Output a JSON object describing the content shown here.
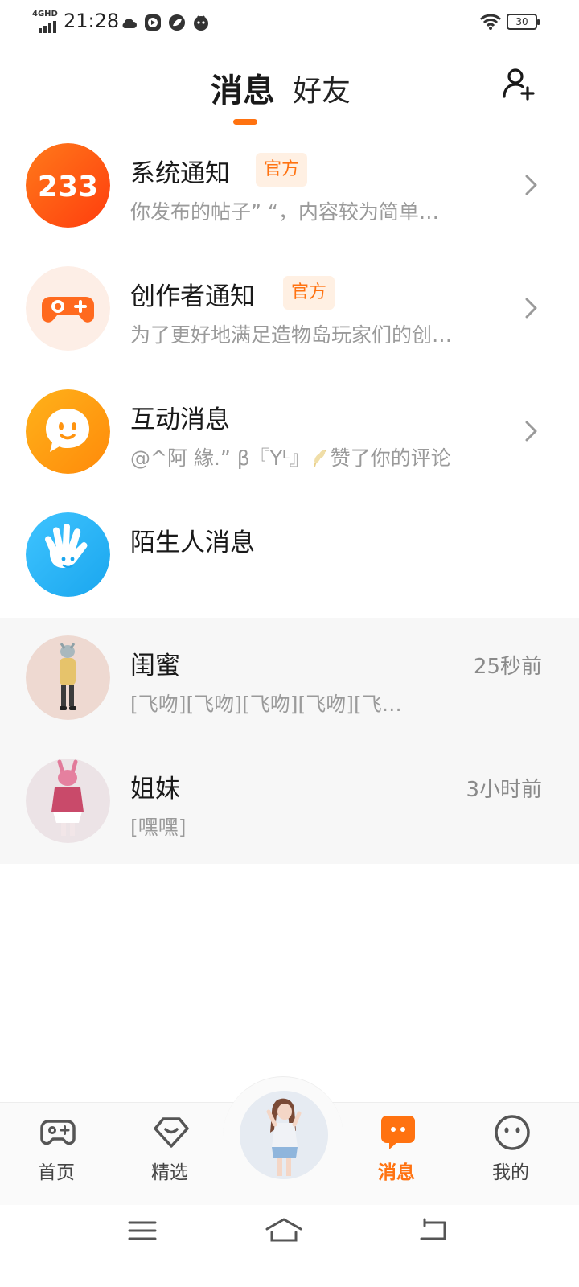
{
  "status_bar": {
    "network": "4GHD",
    "time": "21:28",
    "battery": "30"
  },
  "header": {
    "tab_messages": "消息",
    "tab_friends": "好友"
  },
  "messages": [
    {
      "title": "系统通知",
      "badge": "官方",
      "preview": "你发布的帖子” “，内容较为简单…",
      "icon": "233-logo-icon"
    },
    {
      "title": "创作者通知",
      "badge": "官方",
      "preview": "为了更好地满足造物岛玩家们的创…",
      "icon": "gamepad-icon"
    },
    {
      "title": "互动消息",
      "preview_prefix": "@^阿 緣.” β『Yᴸ』",
      "preview_suffix": "赞了你的评论",
      "icon": "chat-smile-icon"
    },
    {
      "title": "陌生人消息",
      "icon": "wave-hand-icon"
    }
  ],
  "chats": [
    {
      "name": "闺蜜",
      "time": "25秒前",
      "preview": "[飞吻][飞吻][飞吻][飞吻][飞…"
    },
    {
      "name": "姐妹",
      "time": "3小时前",
      "preview": "[嘿嘿]"
    }
  ],
  "bottom_nav": {
    "home": "首页",
    "featured": "精选",
    "messages": "消息",
    "mine": "我的"
  },
  "colors": {
    "accent": "#ff7210",
    "badge_bg": "#fff0e3",
    "system_icon": "#ff5a14",
    "interaction_icon": "#ff9f0f",
    "stranger_icon": "#23b2f5"
  }
}
